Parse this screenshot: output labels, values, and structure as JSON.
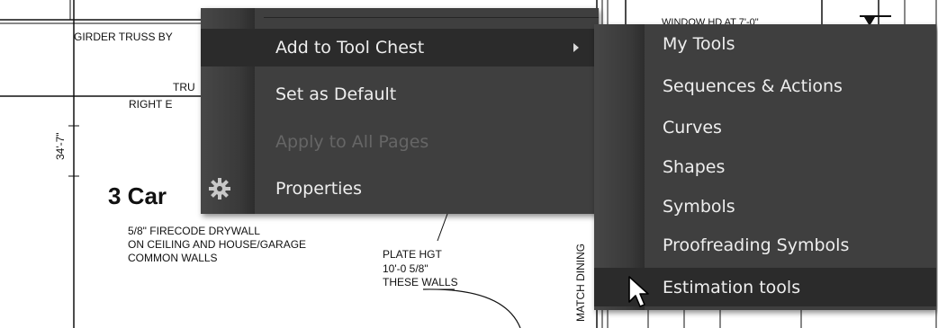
{
  "drawing": {
    "girder_note": "GIRDER TRUSS BY",
    "truss_note": "TRU",
    "right_note": "RIGHT E",
    "dimension": "34'-7\"",
    "room_title": "3 Car",
    "drywall_note": [
      "5/8\" FIRECODE DRYWALL",
      "ON CEILING AND HOUSE/GARAGE",
      "COMMON WALLS"
    ],
    "plate_note": [
      "PLATE HGT",
      "10'-0 5/8\"",
      "THESE WALLS"
    ],
    "match_note": "MATCH DINING",
    "top_note": "WINDOW HD AT 7'-0\""
  },
  "context_menu": {
    "items": [
      {
        "label": "Add to Tool Chest",
        "has_submenu": true,
        "highlighted": true,
        "enabled": true
      },
      {
        "label": "Set as Default",
        "enabled": true
      },
      {
        "label": "Apply to All Pages",
        "enabled": false
      },
      {
        "label": "Properties",
        "icon": "gear-icon",
        "enabled": true
      }
    ]
  },
  "submenu": {
    "items": [
      {
        "label": "My Tools"
      },
      {
        "label": "Sequences & Actions"
      },
      {
        "label": "Curves"
      },
      {
        "label": "Shapes"
      },
      {
        "label": "Symbols"
      },
      {
        "label": "Proofreading Symbols"
      },
      {
        "label": "Estimation tools",
        "hovered": true
      }
    ]
  },
  "colors": {
    "menu_bg": "#3f3f3f",
    "highlight_bg": "#2b2b2b",
    "text": "#eeeeee",
    "disabled_text": "#666666"
  }
}
